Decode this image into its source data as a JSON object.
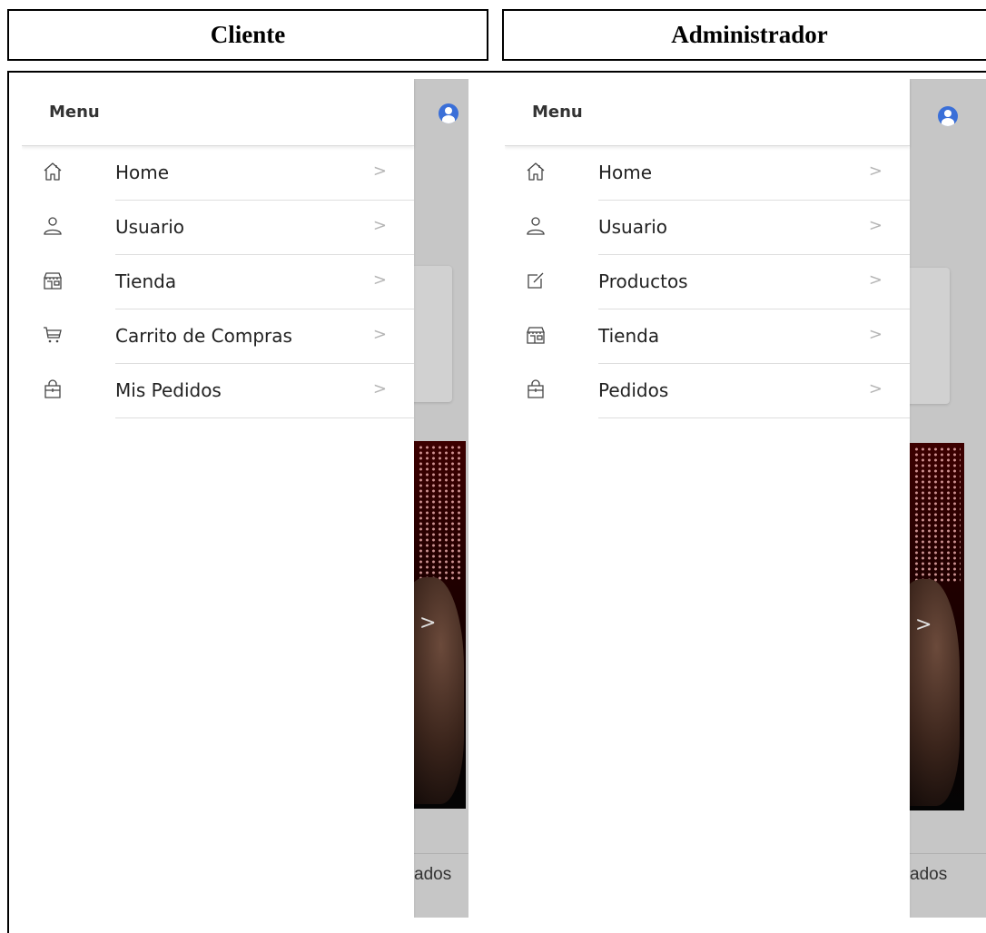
{
  "headers": {
    "cliente": "Cliente",
    "administrador": "Administrador"
  },
  "cliente": {
    "menu_title": "Menu",
    "items": [
      {
        "label": "Home",
        "icon": "home-icon"
      },
      {
        "label": "Usuario",
        "icon": "user-icon"
      },
      {
        "label": "Tienda",
        "icon": "store-icon"
      },
      {
        "label": "Carrito de Compras",
        "icon": "cart-icon"
      },
      {
        "label": "Mis Pedidos",
        "icon": "bag-icon"
      }
    ],
    "background_fragment": "ados",
    "chevron": ">"
  },
  "administrador": {
    "menu_title": "Menu",
    "items": [
      {
        "label": "Home",
        "icon": "home-icon"
      },
      {
        "label": "Usuario",
        "icon": "user-icon"
      },
      {
        "label": "Productos",
        "icon": "edit-icon"
      },
      {
        "label": "Tienda",
        "icon": "store-icon"
      },
      {
        "label": "Pedidos",
        "icon": "bag-icon"
      }
    ],
    "background_fragment": "ados",
    "chevron": ">"
  },
  "colors": {
    "accent": "#3a6fd8",
    "overlay": "#c6c6c6",
    "drawer": "#ffffff"
  }
}
